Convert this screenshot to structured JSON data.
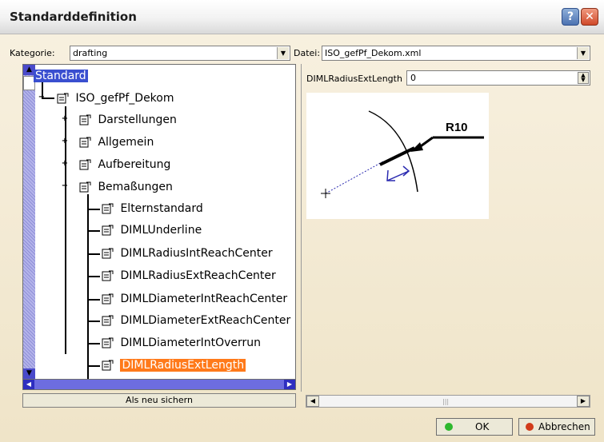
{
  "window": {
    "title": "Standarddefinition"
  },
  "filters": {
    "category_label": "Kategorie:",
    "category_value": "drafting",
    "file_label": "Datei:",
    "file_value": "ISO_gefPf_Dekom.xml"
  },
  "tree": {
    "items": [
      {
        "label": "Standard"
      },
      {
        "label": "ISO_gefPf_Dekom"
      },
      {
        "label": "Darstellungen"
      },
      {
        "label": "Allgemein"
      },
      {
        "label": "Aufbereitung"
      },
      {
        "label": "Bemaßungen"
      },
      {
        "label": "Elternstandard"
      },
      {
        "label": "DIMLUnderline"
      },
      {
        "label": "DIMLRadiusIntReachCenter"
      },
      {
        "label": "DIMLRadiusExtReachCenter"
      },
      {
        "label": "DIMLDiameterIntReachCenter"
      },
      {
        "label": "DIMLDiameterExtReachCenter"
      },
      {
        "label": "DIMLDiameterIntOverrun"
      },
      {
        "label": "DIMLRadiusExtLength"
      }
    ]
  },
  "save_button": {
    "label": "Als neu sichern"
  },
  "property": {
    "name": "DIMLRadiusExtLength",
    "value": "0"
  },
  "preview": {
    "label": "R10"
  },
  "buttons": {
    "ok": "OK",
    "cancel": "Abbrechen"
  },
  "colors": {
    "selection_blue": "#3a4fd0",
    "selection_orange": "#ff7a1a",
    "ok_green": "#2eb82e",
    "cancel_red": "#d23b1a"
  }
}
